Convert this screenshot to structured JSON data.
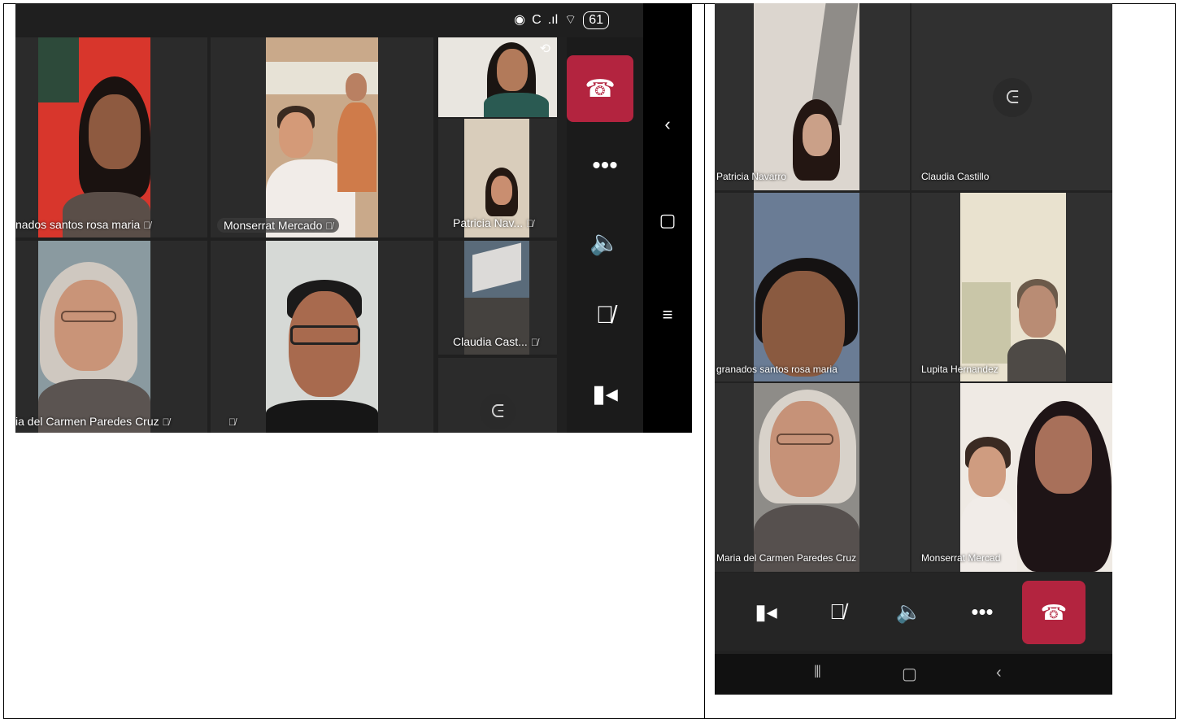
{
  "landscape": {
    "status": {
      "battery": "61"
    },
    "participants": [
      {
        "name": "nados santos rosa maria"
      },
      {
        "name": "Monserrat Mercado"
      },
      {
        "name": "Patricia Nav..."
      },
      {
        "name": "ia del Carmen Paredes Cruz"
      },
      {
        "name": ""
      },
      {
        "name": "Claudia Cast..."
      }
    ],
    "controls": {
      "hangup_icon": "phone-hangup-icon",
      "more_label": "•••"
    },
    "nav": {
      "back": "‹",
      "home": "▢",
      "recents": "≡"
    }
  },
  "portrait": {
    "participants": [
      {
        "name": "Patricia Navarro"
      },
      {
        "name": "Claudia Castillo"
      },
      {
        "name": "granados santos rosa maria"
      },
      {
        "name": "Lupita Hernandez"
      },
      {
        "name": "Maria del Carmen Paredes Cruz"
      },
      {
        "name": "Monserrat Mercad"
      }
    ],
    "controls": {
      "more_label": "•••"
    },
    "nav": {
      "recents": "⦀",
      "home": "▢",
      "back": "‹"
    }
  },
  "colors": {
    "hangup": "#b3243f",
    "background": "#202020"
  }
}
